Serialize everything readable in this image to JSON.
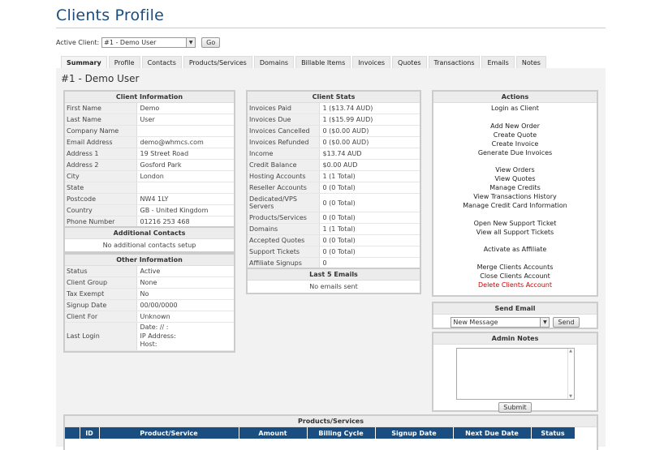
{
  "page_title": "Clients Profile",
  "active_client": {
    "label": "Active Client:",
    "selected": "#1 - Demo User",
    "go_label": "Go"
  },
  "tabs": [
    "Summary",
    "Profile",
    "Contacts",
    "Products/Services",
    "Domains",
    "Billable Items",
    "Invoices",
    "Quotes",
    "Transactions",
    "Emails",
    "Notes"
  ],
  "client_heading": "#1 - Demo User",
  "client_info": {
    "title": "Client Information",
    "rows": [
      {
        "k": "First Name",
        "v": "Demo"
      },
      {
        "k": "Last Name",
        "v": "User"
      },
      {
        "k": "Company Name",
        "v": ""
      },
      {
        "k": "Email Address",
        "v": "demo@whmcs.com"
      },
      {
        "k": "Address 1",
        "v": "19 Street Road"
      },
      {
        "k": "Address 2",
        "v": "Gosford Park"
      },
      {
        "k": "City",
        "v": "London"
      },
      {
        "k": "State",
        "v": ""
      },
      {
        "k": "Postcode",
        "v": "NW4 1LY"
      },
      {
        "k": "Country",
        "v": "GB - United Kingdom"
      },
      {
        "k": "Phone Number",
        "v": "01216 253 468"
      }
    ]
  },
  "additional_contacts": {
    "title": "Additional Contacts",
    "text": "No additional contacts setup"
  },
  "other_info": {
    "title": "Other Information",
    "rows": [
      {
        "k": "Status",
        "v": "Active"
      },
      {
        "k": "Client Group",
        "v": "None"
      },
      {
        "k": "Tax Exempt",
        "v": "No"
      },
      {
        "k": "Signup Date",
        "v": "00/00/0000"
      },
      {
        "k": "Client For",
        "v": "Unknown"
      }
    ],
    "last_login_label": "Last Login",
    "last_login_lines": [
      "Date: // :",
      "IP Address:",
      "Host:"
    ]
  },
  "client_stats": {
    "title": "Client Stats",
    "rows": [
      {
        "k": "Invoices Paid",
        "v": "1 ($13.74 AUD)"
      },
      {
        "k": "Invoices Due",
        "v": "1 ($15.99 AUD)"
      },
      {
        "k": "Invoices Cancelled",
        "v": "0 ($0.00 AUD)"
      },
      {
        "k": "Invoices Refunded",
        "v": "0 ($0.00 AUD)"
      },
      {
        "k": "Income",
        "v": "$13.74 AUD"
      },
      {
        "k": "Credit Balance",
        "v": "$0.00 AUD"
      },
      {
        "k": "Hosting Accounts",
        "v": "1 (1 Total)"
      },
      {
        "k": "Reseller Accounts",
        "v": "0 (0 Total)"
      },
      {
        "k": "Dedicated/VPS Servers",
        "v": "0 (0 Total)"
      },
      {
        "k": "Products/Services",
        "v": "0 (0 Total)"
      },
      {
        "k": "Domains",
        "v": "1 (1 Total)"
      },
      {
        "k": "Accepted Quotes",
        "v": "0 (0 Total)"
      },
      {
        "k": "Support Tickets",
        "v": "0 (0 Total)"
      },
      {
        "k": "Affiliate Signups",
        "v": "0"
      }
    ]
  },
  "last_emails": {
    "title": "Last 5 Emails",
    "text": "No emails sent"
  },
  "actions": {
    "title": "Actions",
    "groups": [
      [
        "Login as Client"
      ],
      [
        "Add New Order",
        "Create Quote",
        "Create Invoice",
        "Generate Due Invoices"
      ],
      [
        "View Orders",
        "View Quotes",
        "Manage Credits",
        "View Transactions History",
        "Manage Credit Card Information"
      ],
      [
        "Open New Support Ticket",
        "View all Support Tickets"
      ],
      [
        "Activate as Affiliate"
      ],
      [
        "Merge Clients Accounts",
        "Close Clients Account",
        "Delete Clients Account"
      ]
    ]
  },
  "send_email": {
    "title": "Send Email",
    "selected": "New Message",
    "send_label": "Send"
  },
  "admin_notes": {
    "title": "Admin Notes",
    "submit_label": "Submit"
  },
  "products": {
    "title": "Products/Services",
    "columns": [
      "ID",
      "Product/Service",
      "Amount",
      "Billing Cycle",
      "Signup Date",
      "Next Due Date",
      "Status"
    ]
  },
  "colors": {
    "brand": "#1a4d80",
    "danger": "#cc0000"
  }
}
